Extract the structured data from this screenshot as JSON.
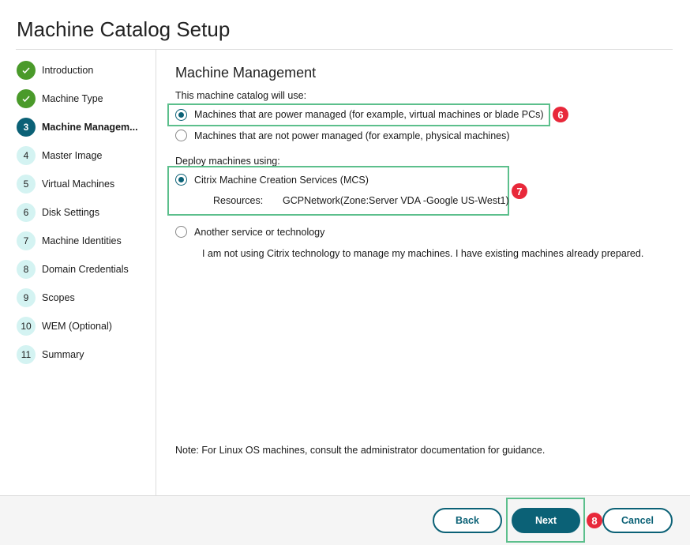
{
  "title": "Machine Catalog Setup",
  "steps": [
    {
      "num": "",
      "label": "Introduction",
      "state": "done"
    },
    {
      "num": "",
      "label": "Machine Type",
      "state": "done"
    },
    {
      "num": "3",
      "label": "Machine Managem...",
      "state": "current"
    },
    {
      "num": "4",
      "label": "Master Image",
      "state": "todo"
    },
    {
      "num": "5",
      "label": "Virtual Machines",
      "state": "todo"
    },
    {
      "num": "6",
      "label": "Disk Settings",
      "state": "todo"
    },
    {
      "num": "7",
      "label": "Machine Identities",
      "state": "todo"
    },
    {
      "num": "8",
      "label": "Domain Credentials",
      "state": "todo"
    },
    {
      "num": "9",
      "label": "Scopes",
      "state": "todo"
    },
    {
      "num": "10",
      "label": "WEM (Optional)",
      "state": "todo"
    },
    {
      "num": "11",
      "label": "Summary",
      "state": "todo"
    }
  ],
  "main": {
    "heading": "Machine Management",
    "catalog_label": "This machine catalog will use:",
    "power_managed": "Machines that are power managed (for example, virtual machines or blade PCs)",
    "not_power_managed": "Machines that are not power managed (for example, physical machines)",
    "deploy_label": "Deploy machines using:",
    "mcs": "Citrix Machine Creation Services (MCS)",
    "resources_label": "Resources:",
    "resources_value": "GCPNetwork(Zone:Server VDA -Google US-West1)",
    "other": "Another service or technology",
    "other_desc": "I am not using Citrix technology to manage my machines. I have existing machines already prepared.",
    "note": "Note: For Linux OS machines, consult the administrator documentation for guidance."
  },
  "badges": [
    "6",
    "7",
    "8"
  ],
  "footer": {
    "back": "Back",
    "next": "Next",
    "cancel": "Cancel"
  }
}
